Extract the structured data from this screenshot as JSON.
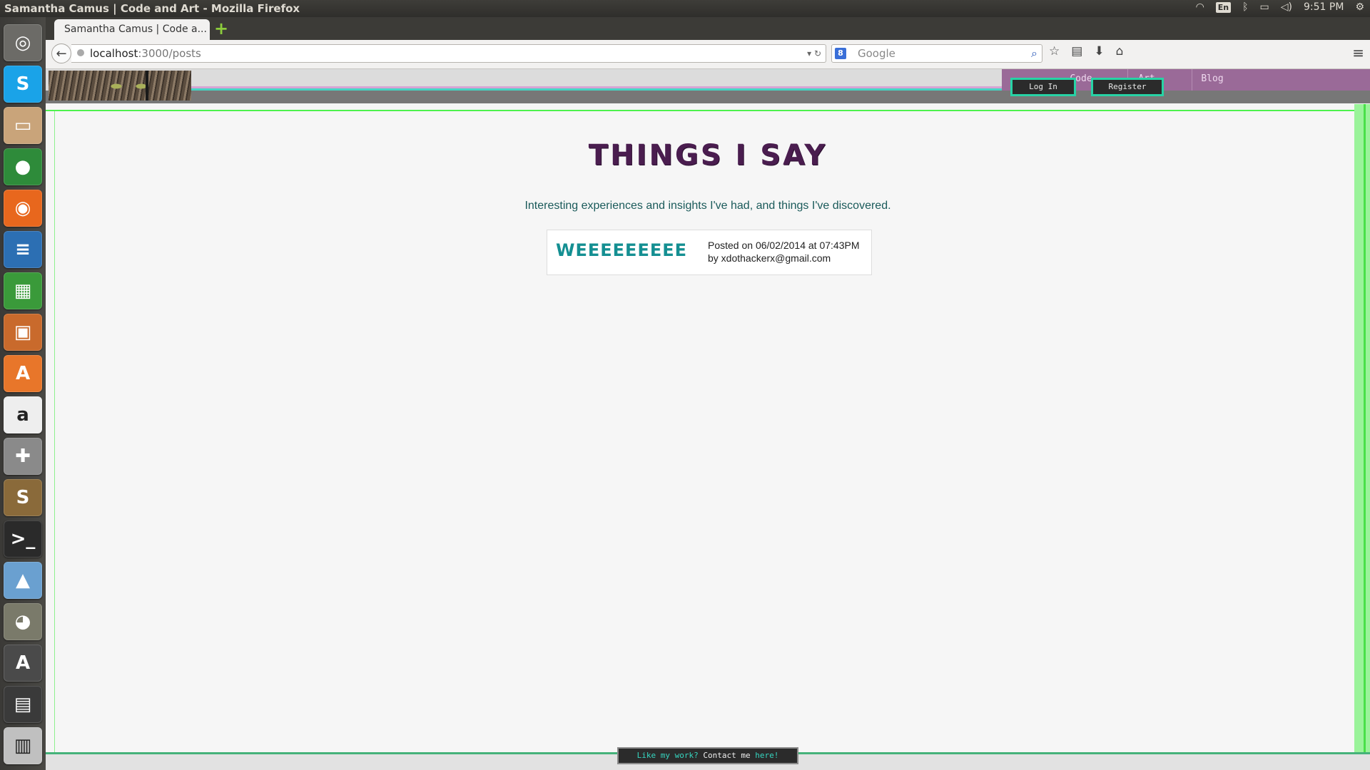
{
  "os_panel": {
    "window_title": "Samantha Camus | Code and Art - Mozilla Firefox",
    "keyboard_layout": "En",
    "clock": "9:51 PM",
    "icons": [
      "wifi-icon",
      "keyboard-icon",
      "bluetooth-icon",
      "battery-icon",
      "volume-icon",
      "settings-icon"
    ]
  },
  "launcher": {
    "apps": [
      {
        "name": "dash-home",
        "glyph": "◎",
        "color": "#6c6b67"
      },
      {
        "name": "skype",
        "glyph": "S",
        "color": "#1aa3e8"
      },
      {
        "name": "files",
        "glyph": "▭",
        "color": "#c9a47a"
      },
      {
        "name": "chrome",
        "glyph": "●",
        "color": "#2e8b3a"
      },
      {
        "name": "firefox",
        "glyph": "◉",
        "color": "#e8671d"
      },
      {
        "name": "writer",
        "glyph": "≡",
        "color": "#2c6fb3"
      },
      {
        "name": "calc",
        "glyph": "▦",
        "color": "#3a9a3a"
      },
      {
        "name": "impress",
        "glyph": "▣",
        "color": "#c96a2c"
      },
      {
        "name": "software-center",
        "glyph": "A",
        "color": "#e8762a"
      },
      {
        "name": "amazon",
        "glyph": "a",
        "color": "#eeeeee"
      },
      {
        "name": "system-settings",
        "glyph": "✚",
        "color": "#8a8a8a"
      },
      {
        "name": "sublime-text",
        "glyph": "S",
        "color": "#8a6a3a"
      },
      {
        "name": "terminal",
        "glyph": ">_",
        "color": "#2a2a2a"
      },
      {
        "name": "image-viewer",
        "glyph": "▲",
        "color": "#6aa0d0"
      },
      {
        "name": "gimp",
        "glyph": "◕",
        "color": "#7a7a6a"
      },
      {
        "name": "software-updater",
        "glyph": "A",
        "color": "#4a4a4a"
      },
      {
        "name": "drawer",
        "glyph": "▤",
        "color": "#3a3a3a"
      },
      {
        "name": "trash",
        "glyph": "▥",
        "color": "#c0c0c0"
      }
    ]
  },
  "browser": {
    "tab_title": "Samantha Camus | Code a...",
    "new_tab_symbol": "+",
    "url_host": "localhost",
    "url_path": ":3000/posts",
    "search_placeholder": "Google",
    "search_engine_badge": "8"
  },
  "site": {
    "nav": {
      "login": "Log In",
      "register": "Register",
      "links": [
        "Code",
        "Art",
        "Blog"
      ]
    },
    "title": "THINGS I SAY",
    "subtitle": "Interesting experiences and insights I've had, and things I've discovered.",
    "posts": [
      {
        "title": "WEEEEEEEEE",
        "posted_on": "Posted on 06/02/2014 at 07:43PM",
        "author": "by xdothackerx@gmail.com"
      }
    ],
    "footer": {
      "question": "Like my work?",
      "contact": "Contact me",
      "link": "here!"
    }
  }
}
